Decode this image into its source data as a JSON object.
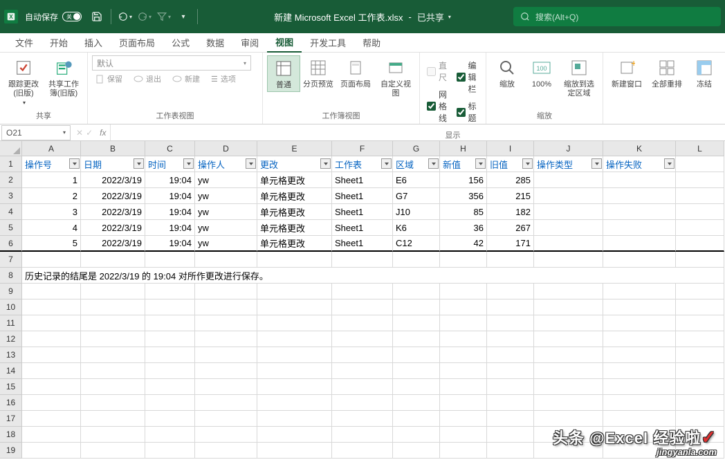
{
  "titlebar": {
    "autosave_label": "自动保存",
    "autosave_toggle": "关",
    "filename": "新建 Microsoft Excel 工作表.xlsx",
    "shared_label": "已共享",
    "search_placeholder": "搜索(Alt+Q)"
  },
  "tabs": {
    "items": [
      "文件",
      "开始",
      "插入",
      "页面布局",
      "公式",
      "数据",
      "审阅",
      "视图",
      "开发工具",
      "帮助"
    ],
    "active_index": 7
  },
  "ribbon": {
    "share_group": {
      "label": "共享",
      "track_changes": "跟踪更改(旧版)",
      "share_workbook": "共享工作簿(旧版)"
    },
    "sheet_view_group": {
      "label": "工作表视图",
      "dropdown": "默认",
      "keep": "保留",
      "exit": "退出",
      "new": "新建",
      "options": "选项"
    },
    "workbook_view_group": {
      "label": "工作簿视图",
      "normal": "普通",
      "pagebreak": "分页预览",
      "pagelayout": "页面布局",
      "custom": "自定义视图"
    },
    "show_group": {
      "label": "显示",
      "ruler": "直尺",
      "gridlines": "网格线",
      "formula_bar": "编辑栏",
      "headings": "标题"
    },
    "zoom_group": {
      "label": "缩放",
      "zoom": "缩放",
      "hundred": "100%",
      "zoom_selection": "缩放到选定区域"
    },
    "window_group": {
      "new_window": "新建窗口",
      "arrange_all": "全部重排",
      "freeze": "冻结"
    }
  },
  "formula_bar": {
    "name_box": "O21"
  },
  "columns": {
    "widths": [
      85,
      93,
      72,
      90,
      108,
      88,
      68,
      68,
      68,
      100,
      105,
      70
    ],
    "letters": [
      "A",
      "B",
      "C",
      "D",
      "E",
      "F",
      "G",
      "H",
      "I",
      "J",
      "K",
      "L"
    ]
  },
  "headers": [
    "操作号",
    "日期",
    "时间",
    "操作人",
    "更改",
    "工作表",
    "区域",
    "新值",
    "旧值",
    "操作类型",
    "操作失败"
  ],
  "data_rows": [
    {
      "num": "1",
      "date": "2022/3/19",
      "time": "19:04",
      "user": "yw",
      "change": "单元格更改",
      "sheet": "Sheet1",
      "range": "E6",
      "new": "156",
      "old": "285"
    },
    {
      "num": "2",
      "date": "2022/3/19",
      "time": "19:04",
      "user": "yw",
      "change": "单元格更改",
      "sheet": "Sheet1",
      "range": "G7",
      "new": "356",
      "old": "215"
    },
    {
      "num": "3",
      "date": "2022/3/19",
      "time": "19:04",
      "user": "yw",
      "change": "单元格更改",
      "sheet": "Sheet1",
      "range": "J10",
      "new": "85",
      "old": "182"
    },
    {
      "num": "4",
      "date": "2022/3/19",
      "time": "19:04",
      "user": "yw",
      "change": "单元格更改",
      "sheet": "Sheet1",
      "range": "K6",
      "new": "36",
      "old": "267"
    },
    {
      "num": "5",
      "date": "2022/3/19",
      "time": "19:04",
      "user": "yw",
      "change": "单元格更改",
      "sheet": "Sheet1",
      "range": "C12",
      "new": "42",
      "old": "171"
    }
  ],
  "footer_text": "历史记录的结尾是 2022/3/19 的 19:04 对所作更改进行保存。",
  "row_numbers": [
    "1",
    "2",
    "3",
    "4",
    "5",
    "6",
    "7",
    "8",
    "9",
    "10",
    "11",
    "12",
    "13",
    "14",
    "15",
    "16",
    "17",
    "18",
    "19"
  ],
  "watermark": {
    "line1": "头条 @Excel 经验啦",
    "line2": "jingyanla.com"
  }
}
